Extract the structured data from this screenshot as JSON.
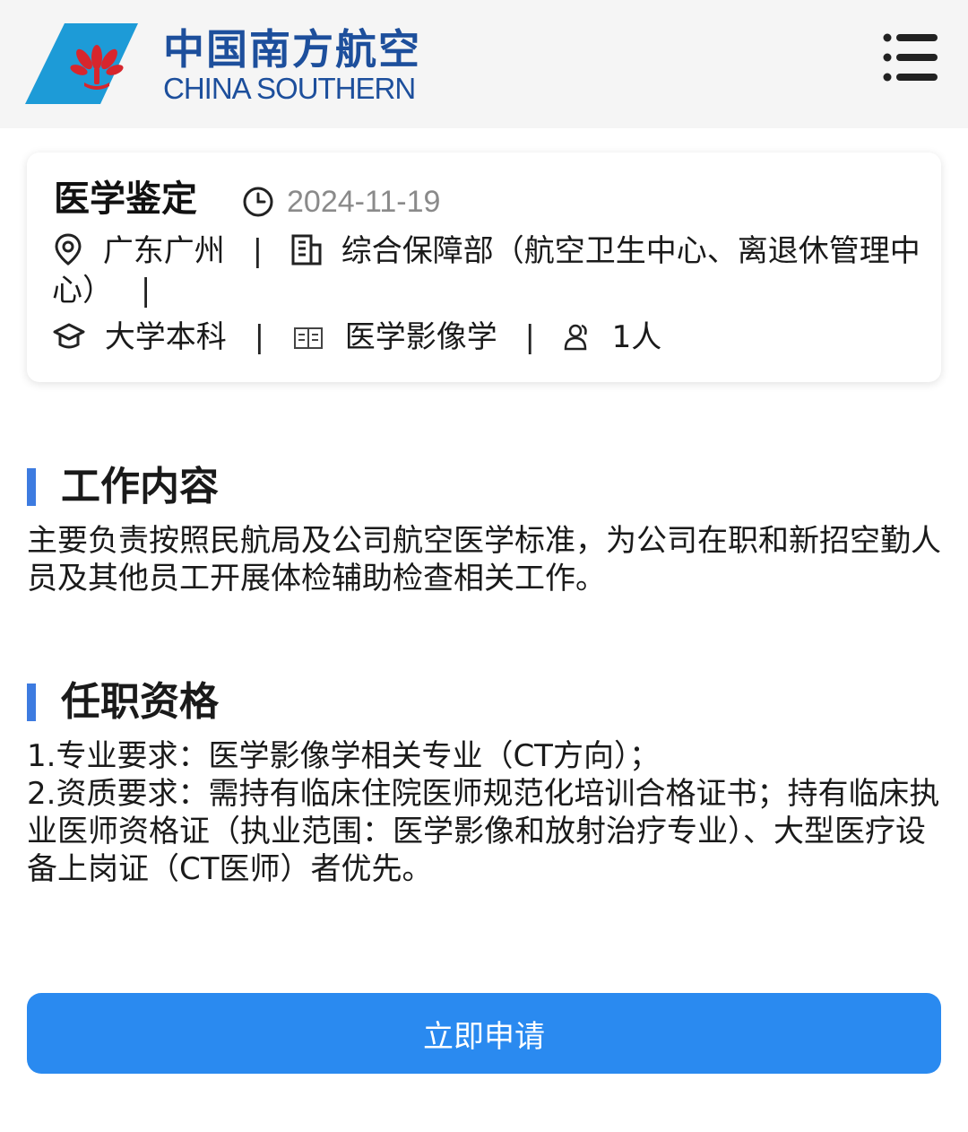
{
  "header": {
    "brand_cn": "中国南方航空",
    "brand_en": "CHINA SOUTHERN",
    "logo_color": "#1d9bd7",
    "flower_color": "#d7262d",
    "menu_icon": "hamburger-menu-icon"
  },
  "job": {
    "title": "医学鉴定",
    "date": "2024-11-19",
    "location": "广东广州",
    "department": "综合保障部（航空卫生中心、离退休管理中心）",
    "education": "大学本科",
    "major": "医学影像学",
    "headcount": "1人",
    "separator": "|",
    "icons": {
      "date": "clock-icon",
      "location": "location-pin-icon",
      "department": "building-icon",
      "education": "graduation-cap-icon",
      "major": "book-icon",
      "headcount": "people-icon"
    }
  },
  "sections": {
    "duties_title": "工作内容",
    "duties_text": "主要负责按照民航局及公司航空医学标准，为公司在职和新招空勤人员及其他员工开展体检辅助检查相关工作。",
    "requirements_title": "任职资格",
    "requirement_1": "1.专业要求：医学影像学相关专业（CT方向）；",
    "requirement_2": "2.资质要求：需持有临床住院医师规范化培训合格证书；持有临床执业医师资格证（执业范围：医学影像和放射治疗专业）、大型医疗设备上岗证（CT医师）者优先。"
  },
  "actions": {
    "apply_label": "立即申请",
    "accent_color": "#2a8af0"
  }
}
